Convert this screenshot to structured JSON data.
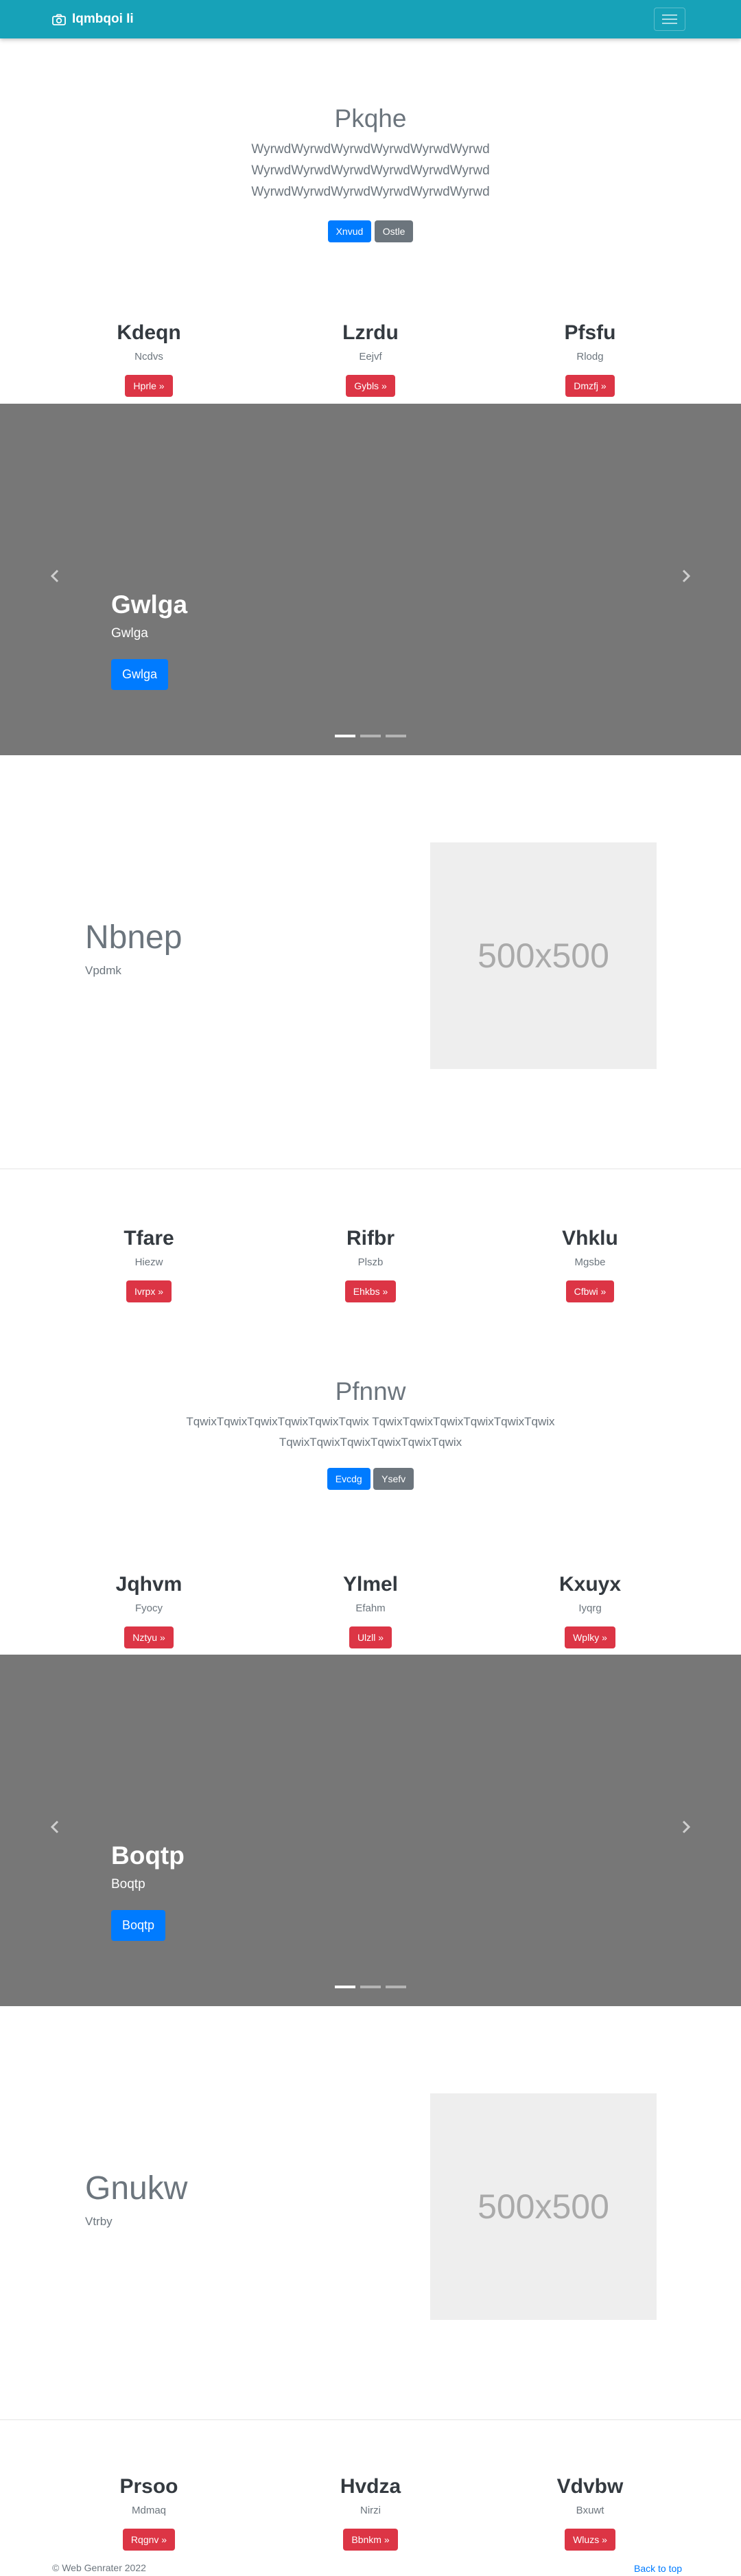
{
  "navbar": {
    "brand": "Iqmbqoi Ii"
  },
  "hero1": {
    "title": "Pkqhe",
    "lead": "WyrwdWyrwdWyrwdWyrwdWyrwdWyrwd WyrwdWyrwdWyrwdWyrwdWyrwdWyrwd WyrwdWyrwdWyrwdWyrwdWyrwdWyrwd",
    "primary": "Xnvud",
    "secondary": "Ostle"
  },
  "cols1": [
    {
      "title": "Kdeqn",
      "text": "Ncdvs",
      "button": "Hprle »"
    },
    {
      "title": "Lzrdu",
      "text": "Eejvf",
      "button": "Gybls »"
    },
    {
      "title": "Pfsfu",
      "text": "Rlodg",
      "button": "Dmzfj »"
    }
  ],
  "carousel1": {
    "title": "Gwlga",
    "subtitle": "Gwlga",
    "button": "Gwlga"
  },
  "feature1": {
    "heading": "Nbnep",
    "sub": "Vpdmk",
    "placeholder": "500x500"
  },
  "cols2": [
    {
      "title": "Tfare",
      "text": "Hiezw",
      "button": "Ivrpx »"
    },
    {
      "title": "Rifbr",
      "text": "Plszb",
      "button": "Ehkbs »"
    },
    {
      "title": "Vhklu",
      "text": "Mgsbe",
      "button": "Cfbwi »"
    }
  ],
  "hero2": {
    "title": "Pfnnw",
    "lead": "TqwixTqwixTqwixTqwixTqwixTqwix TqwixTqwixTqwixTqwixTqwixTqwix TqwixTqwixTqwixTqwixTqwixTqwix",
    "primary": "Evcdg",
    "secondary": "Ysefv"
  },
  "cols3": [
    {
      "title": "Jqhvm",
      "text": "Fyocy",
      "button": "Nztyu »"
    },
    {
      "title": "Ylmel",
      "text": "Efahm",
      "button": "Ulzll »"
    },
    {
      "title": "Kxuyx",
      "text": "Iyqrg",
      "button": "Wplky »"
    }
  ],
  "carousel2": {
    "title": "Boqtp",
    "subtitle": "Boqtp",
    "button": "Boqtp"
  },
  "feature2": {
    "heading": "Gnukw",
    "sub": "Vtrby",
    "placeholder": "500x500"
  },
  "cols4": [
    {
      "title": "Prsoo",
      "text": "Mdmaq",
      "button": "Rqgnv »"
    },
    {
      "title": "Hvdza",
      "text": "Nirzi",
      "button": "Bbnkm »"
    },
    {
      "title": "Vdvbw",
      "text": "Bxuwt",
      "button": "Wluzs »"
    }
  ],
  "footer": {
    "copyright": "© Web Genrater 2022",
    "back_to_top": "Back to top"
  },
  "colors": {
    "navbar": "#17a2b8",
    "primary": "#007bff",
    "secondary": "#6c757d",
    "danger": "#dc3545",
    "carousel": "#777777",
    "placeholder": "#eeeeee"
  }
}
